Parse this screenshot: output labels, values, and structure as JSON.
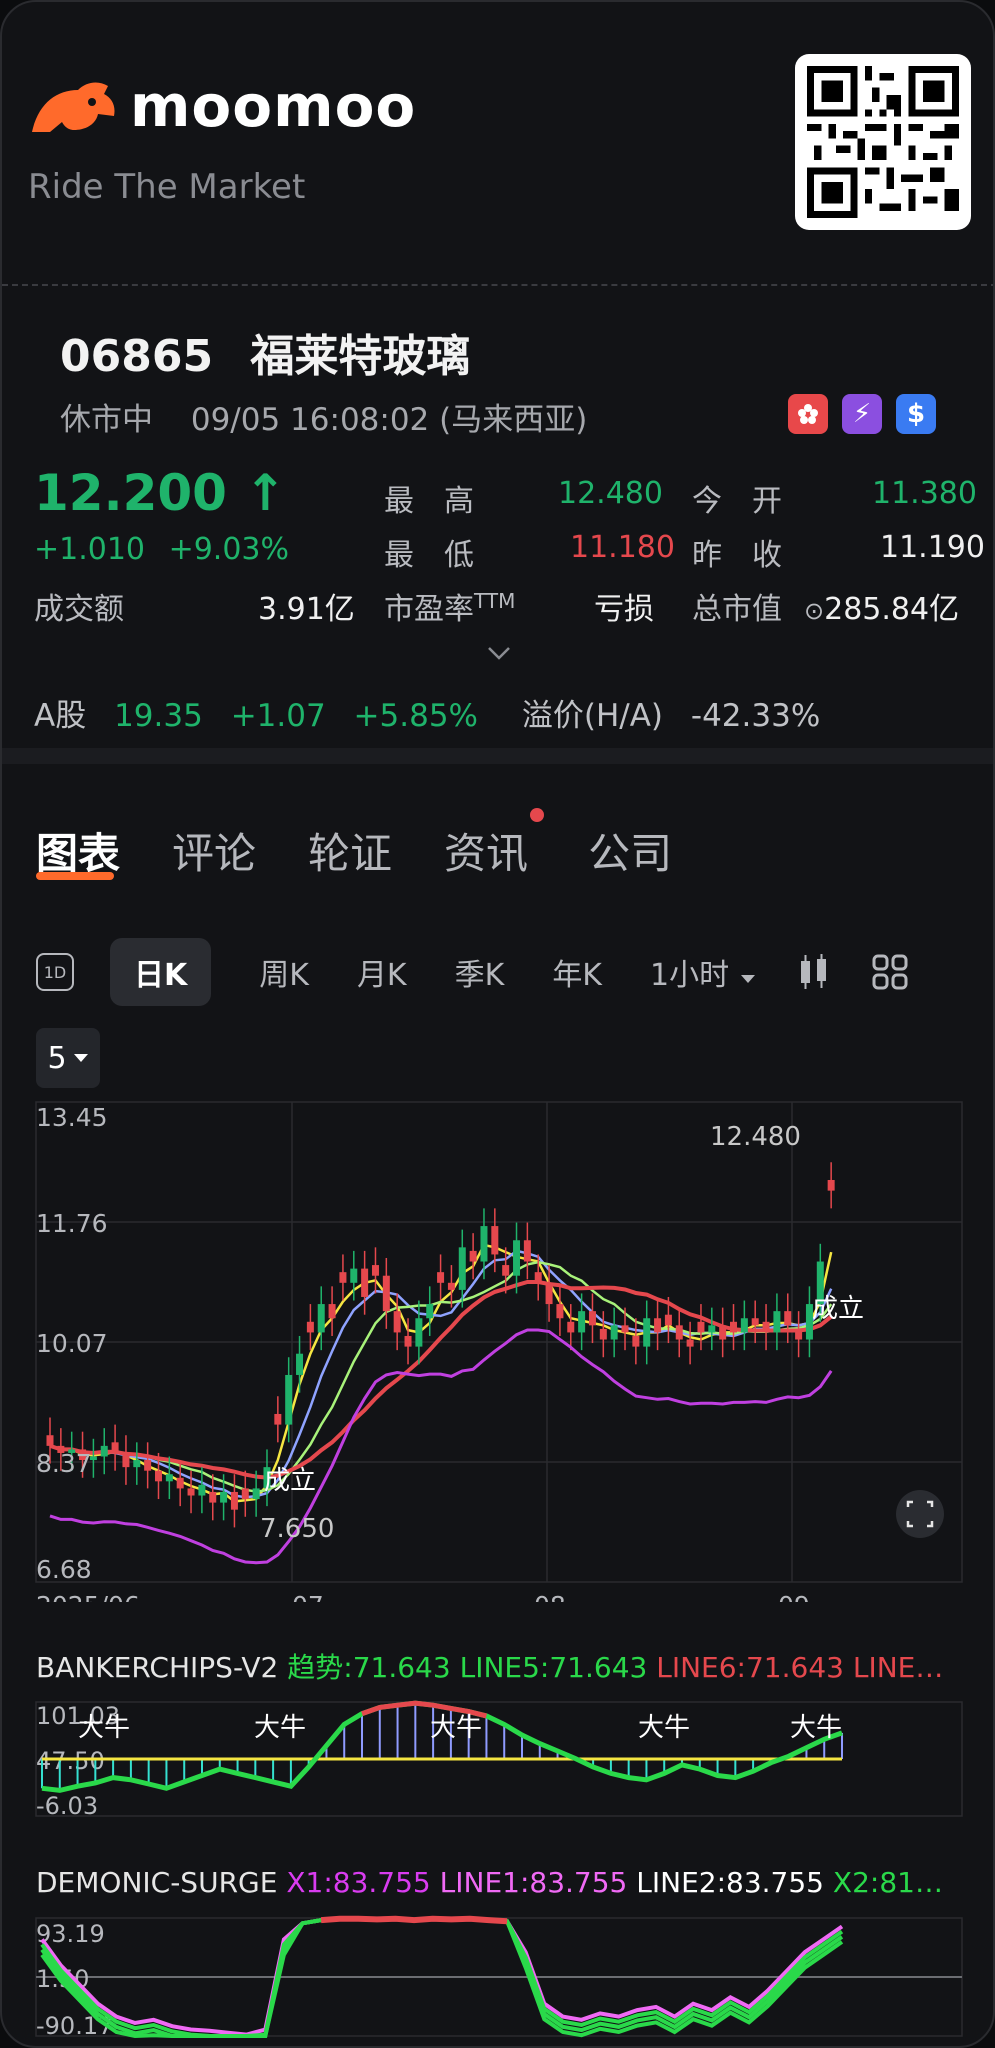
{
  "brand": {
    "name": "moomoo",
    "tagline": "Ride The Market"
  },
  "stock": {
    "code": "06865",
    "name": "福莱特玻璃",
    "market_status": "休市中",
    "datetime": "09/05 16:08:02 (马来西亚)",
    "price": "12.200",
    "price_arrow": "↑",
    "change": "+1.010",
    "change_pct": "+9.03%",
    "turnover_label": "成交额",
    "turnover": "3.91亿",
    "high_label": "最　高",
    "high": "12.480",
    "low_label": "最　低",
    "low": "11.180",
    "open_label": "今　开",
    "open": "11.380",
    "prev_close_label": "昨　收",
    "prev_close": "11.190",
    "pe_label": "市盈率",
    "pe_sup": "TTM",
    "pe": "亏损",
    "mcap_label": "总市值",
    "mcap": "285.84亿",
    "expand_icon": "chevron-down"
  },
  "ashare": {
    "label": "A股",
    "price": "19.35",
    "change": "+1.07",
    "change_pct": "+5.85%",
    "premium_label": "溢价(H/A)",
    "premium": "-42.33%"
  },
  "badges": [
    "HK",
    "⚡",
    "$"
  ],
  "tabs": [
    "图表",
    "评论",
    "轮证",
    "资讯",
    "公司"
  ],
  "periods": {
    "d1": "1D",
    "items": [
      "日K",
      "周K",
      "月K",
      "季K",
      "年K"
    ],
    "interval": "1小时"
  },
  "ma_selector": "5",
  "chart_data": {
    "type": "candlestick",
    "y_ticks": [
      "13.45",
      "11.76",
      "10.07",
      "8.37",
      "6.68"
    ],
    "x_ticks": [
      "2025/06",
      "07",
      "08",
      "09"
    ],
    "annotations": {
      "high_label": "12.480",
      "low_label": "7.650",
      "signal_text": "成立"
    },
    "closes": [
      8.6,
      8.5,
      8.55,
      8.4,
      8.45,
      8.6,
      8.5,
      8.3,
      8.4,
      8.25,
      8.1,
      8.2,
      8.0,
      7.9,
      8.05,
      7.8,
      7.95,
      7.7,
      7.85,
      8.0,
      8.3,
      8.9,
      9.6,
      9.9,
      10.2,
      10.6,
      10.4,
      10.9,
      11.1,
      10.7,
      11.0,
      10.5,
      10.2,
      10.0,
      10.4,
      10.6,
      10.9,
      10.8,
      11.4,
      11.2,
      11.7,
      11.3,
      11.0,
      11.5,
      11.2,
      10.9,
      10.6,
      10.4,
      10.2,
      10.5,
      10.3,
      10.1,
      10.3,
      10.2,
      10.0,
      10.4,
      10.2,
      10.3,
      10.1,
      10.0,
      10.2,
      10.3,
      10.1,
      10.2,
      10.4,
      10.3,
      10.2,
      10.5,
      10.3,
      10.1,
      10.6,
      11.2,
      12.2
    ]
  },
  "bankerchips": {
    "title": "BANKERCHIPS-V2",
    "trend": "趋势:71.643",
    "line5": "LINE5:71.643",
    "line6": "LINE6:71.643",
    "line_more": "LINE…",
    "y_ticks": [
      "101.03",
      "47.50",
      "-6.03"
    ],
    "labels": [
      "大牛",
      "大牛",
      "大牛",
      "大牛",
      "大牛"
    ],
    "curve": [
      20,
      18,
      22,
      25,
      30,
      28,
      24,
      20,
      26,
      32,
      38,
      34,
      30,
      26,
      22,
      40,
      60,
      80,
      90,
      96,
      98,
      100,
      98,
      95,
      92,
      88,
      80,
      70,
      62,
      55,
      48,
      40,
      34,
      30,
      28,
      34,
      42,
      38,
      32,
      30,
      36,
      44,
      50,
      58,
      66,
      72
    ]
  },
  "demonic": {
    "title": "DEMONIC-SURGE",
    "x1": "X1:83.755",
    "line1": "LINE1:83.755",
    "line2": "LINE2:83.755",
    "x2": "X2:81…",
    "y_ticks": [
      "93.19",
      "1.50",
      "-90.17"
    ],
    "curve": [
      60,
      20,
      -10,
      -40,
      -60,
      -70,
      -65,
      -75,
      -80,
      -82,
      -85,
      -88,
      -80,
      60,
      85,
      90,
      92,
      92,
      91,
      92,
      90,
      92,
      91,
      92,
      90,
      88,
      40,
      -40,
      -60,
      -65,
      -55,
      -60,
      -50,
      -45,
      -60,
      -40,
      -50,
      -30,
      -45,
      -20,
      10,
      40,
      60,
      80
    ]
  },
  "colors": {
    "up": "#1fb36b",
    "down": "#e5484d",
    "accent": "#ff6a2b"
  }
}
